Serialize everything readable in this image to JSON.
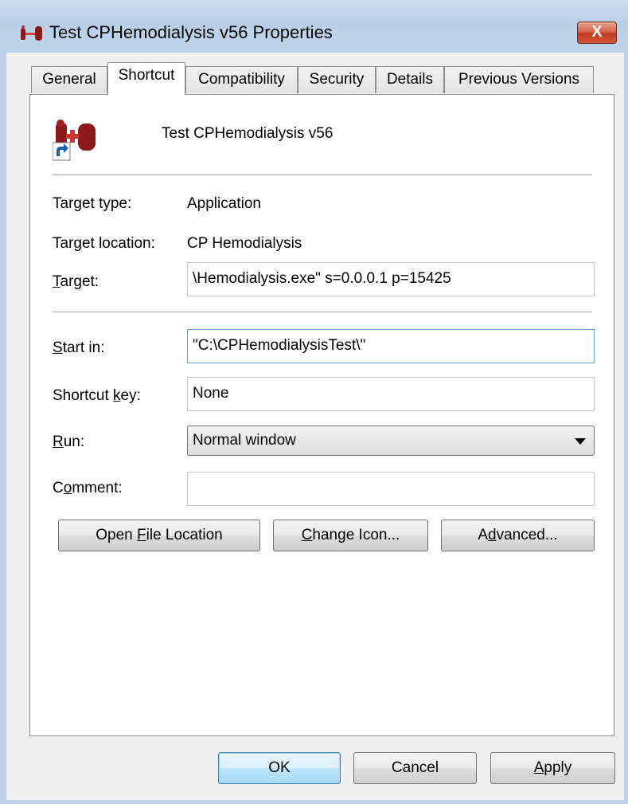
{
  "window": {
    "title": "Test CPHemodialysis v56 Properties",
    "close_label": "X"
  },
  "tabs": [
    {
      "label": "General"
    },
    {
      "label": "Shortcut"
    },
    {
      "label": "Compatibility"
    },
    {
      "label": "Security"
    },
    {
      "label": "Details"
    },
    {
      "label": "Previous Versions"
    }
  ],
  "shortcut": {
    "name": "Test CPHemodialysis v56",
    "target_type_label": "Target type:",
    "target_type_value": "Application",
    "target_location_label": "Target location:",
    "target_location_value": "CP Hemodialysis",
    "target_label_rest": "arget:",
    "target_label_key": "T",
    "target_value": "\\Hemodialysis.exe\" s=0.0.0.1 p=15425",
    "start_in_label_key": "S",
    "start_in_label_rest": "tart in:",
    "start_in_value": "\"C:\\CPHemodialysisTest\\\"",
    "shortcut_key_label_pre": "Shortcut ",
    "shortcut_key_label_key": "k",
    "shortcut_key_label_rest": "ey:",
    "shortcut_key_value": "None",
    "run_label_key": "R",
    "run_label_rest": "un:",
    "run_value": "Normal window",
    "comment_label_pre": "C",
    "comment_label_key": "o",
    "comment_label_rest": "mment:",
    "comment_value": ""
  },
  "buttons": {
    "open_file_location_pre": "Open ",
    "open_file_location_key": "F",
    "open_file_location_rest": "ile Location",
    "change_icon_key": "C",
    "change_icon_rest": "hange Icon...",
    "advanced_pre": "A",
    "advanced_key": "d",
    "advanced_rest": "vanced...",
    "ok": "OK",
    "cancel": "Cancel",
    "apply_key": "A",
    "apply_rest": "pply"
  },
  "colors": {
    "frame": "#bcd3ea",
    "close_button": "#c23b22",
    "focus_border": "#5a9ad6"
  },
  "icons": {
    "title_icon": "shortcut-app-icon",
    "shortcut_icon": "shortcut-app-icon",
    "overlay": "shortcut-arrow-icon"
  }
}
